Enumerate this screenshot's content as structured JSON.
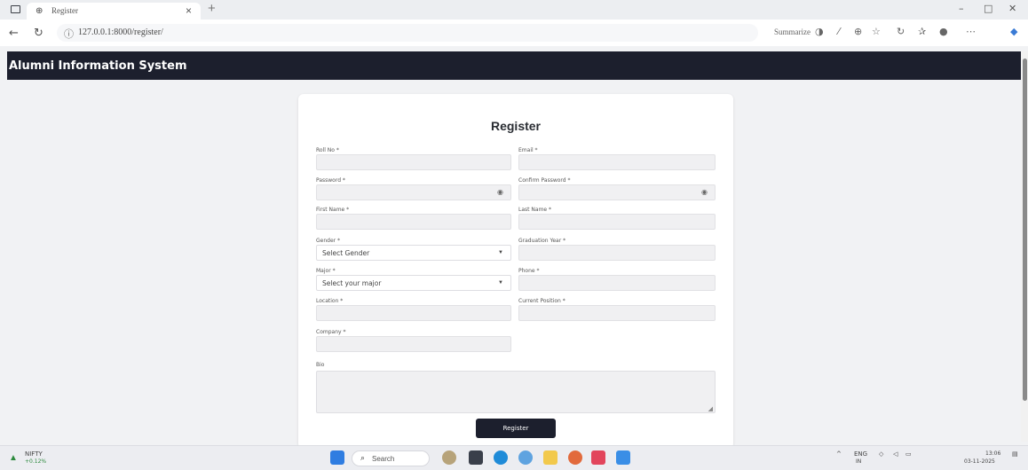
{
  "browser": {
    "tab_title": "Register",
    "url": "127.0.0.1:8000/register/",
    "summarize_label": "Summarize"
  },
  "app": {
    "title": "Alumni Information System"
  },
  "form": {
    "title": "Register",
    "fields": {
      "roll_no": "Roll No *",
      "email": "Email *",
      "password": "Password *",
      "confirm_password": "Confirm Password *",
      "first_name": "First Name *",
      "last_name": "Last Name *",
      "gender": "Gender *",
      "graduation_year": "Graduation Year *",
      "major": "Major *",
      "phone": "Phone *",
      "location": "Location *",
      "current_position": "Current Position *",
      "company": "Company *",
      "bio": "Bio"
    },
    "gender_selected": "Select Gender",
    "major_selected": "Select your major",
    "submit_label": "Register"
  },
  "taskbar": {
    "nifty_label": "NIFTY",
    "nifty_change": "+0.12%",
    "search_label": "Search",
    "language": "ENG",
    "region": "IN",
    "time": "13:06",
    "date": "03-11-2025"
  }
}
